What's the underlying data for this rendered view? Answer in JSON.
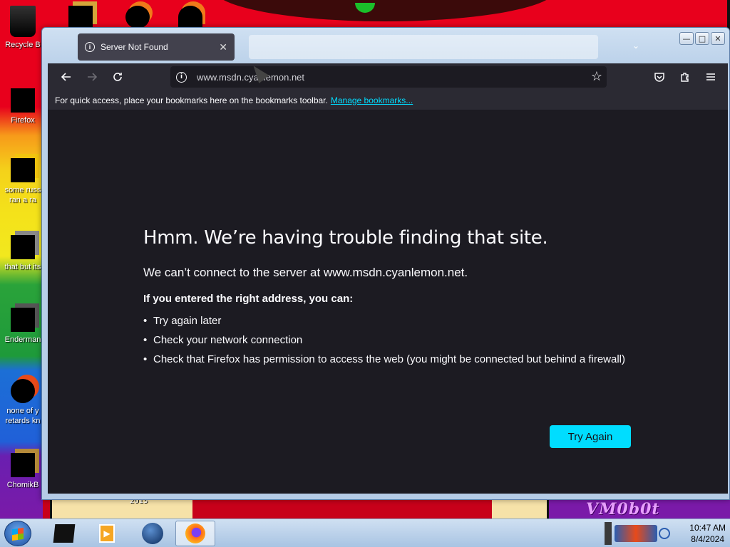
{
  "desktop": {
    "icons": [
      {
        "label": "Recycle B"
      },
      {
        "label": "Firefox"
      },
      {
        "label": "some russ",
        "label2": "ran a ra"
      },
      {
        "label": "that but its"
      },
      {
        "label": "Enderman"
      },
      {
        "label": "none of y",
        "label2": "retards kn"
      },
      {
        "label": "ChomikB"
      }
    ],
    "year": "2015",
    "vm_label": "VM0b0t"
  },
  "browser": {
    "tab_title": "Server Not Found",
    "url": "www.msdn.cyanlemon.net",
    "bookmarks_text": "For quick access, place your bookmarks here on the bookmarks toolbar.",
    "bookmarks_link": "Manage bookmarks...",
    "error": {
      "title": "Hmm. We’re having trouble finding that site.",
      "message": "We can’t connect to the server at www.msdn.cyanlemon.net.",
      "intro": "If you entered the right address, you can:",
      "suggestions": [
        "Try again later",
        "Check your network connection",
        "Check that Firefox has permission to access the web (you might be connected but behind a firewall)"
      ],
      "button": "Try Again"
    }
  },
  "taskbar": {
    "clock_time": "10:47 AM",
    "clock_date": "8/4/2024"
  },
  "colors": {
    "accent": "#00ddff",
    "content_bg": "#1c1b22",
    "toolbar_bg": "#2b2a33"
  }
}
